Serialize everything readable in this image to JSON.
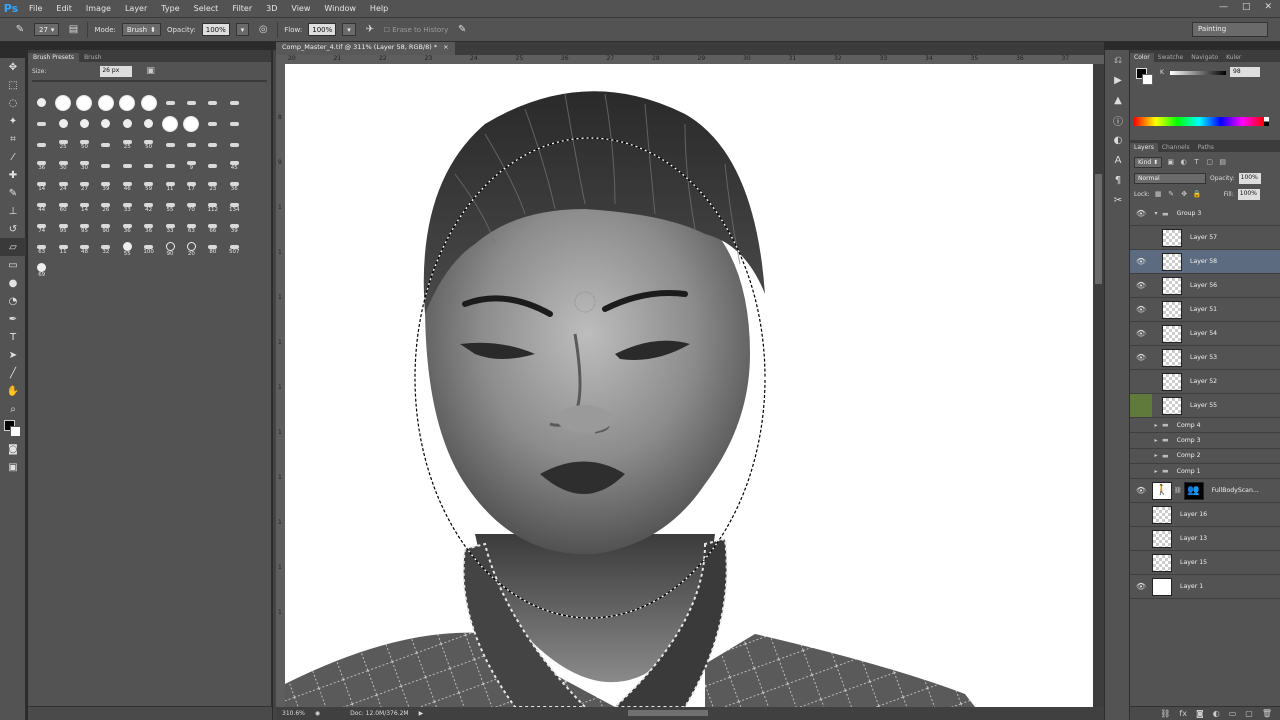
{
  "menubar": {
    "logo": "Ps",
    "items": [
      "File",
      "Edit",
      "Image",
      "Layer",
      "Type",
      "Select",
      "Filter",
      "3D",
      "View",
      "Window",
      "Help"
    ],
    "window_controls": [
      "—",
      "□",
      "✕"
    ]
  },
  "options": {
    "brush_size": "27",
    "mode_label": "Mode:",
    "mode_value": "Brush",
    "opacity_label": "Opacity:",
    "opacity_value": "100%",
    "flow_label": "Flow:",
    "flow_value": "100%",
    "erase_history": "Erase to History",
    "workspace": "Painting"
  },
  "brush_panel": {
    "tabs": [
      "Brush Presets",
      "Brush"
    ],
    "size_label": "Size:",
    "size_value": "26 px",
    "brushes": [
      [
        "",
        "sm"
      ],
      [
        "",
        "lg"
      ],
      [
        "",
        "lg"
      ],
      [
        "",
        "lg"
      ],
      [
        "",
        "lg"
      ],
      [
        "",
        "lg"
      ],
      [
        "",
        "tiny"
      ],
      [
        "",
        "tiny"
      ],
      [
        "",
        "tiny"
      ],
      [
        "",
        "tiny"
      ],
      [
        "",
        "tiny"
      ],
      [
        "",
        "sm"
      ],
      [
        "",
        "sm"
      ],
      [
        "",
        "sm"
      ],
      [
        "",
        "sm"
      ],
      [
        "",
        "sm"
      ],
      [
        "",
        "lg"
      ],
      [
        "",
        "lg"
      ],
      [
        "",
        "tiny"
      ],
      [
        "",
        "tiny"
      ],
      [
        "",
        "tiny"
      ],
      [
        "25",
        "tiny"
      ],
      [
        "50",
        "tiny"
      ],
      [
        "",
        "tiny"
      ],
      [
        "25",
        "tiny"
      ],
      [
        "50",
        "tiny"
      ],
      [
        "",
        "tiny"
      ],
      [
        "",
        "tiny"
      ],
      [
        "",
        "tiny"
      ],
      [
        "",
        "tiny"
      ],
      [
        "36",
        "tiny"
      ],
      [
        "30",
        "tiny"
      ],
      [
        "30",
        "tiny"
      ],
      [
        "",
        "tiny"
      ],
      [
        "",
        "tiny"
      ],
      [
        "",
        "tiny"
      ],
      [
        "",
        "tiny"
      ],
      [
        "9",
        "tiny"
      ],
      [
        "",
        "tiny"
      ],
      [
        "45",
        "tiny"
      ],
      [
        "14",
        "tiny"
      ],
      [
        "24",
        "tiny"
      ],
      [
        "27",
        "tiny"
      ],
      [
        "39",
        "tiny"
      ],
      [
        "46",
        "tiny"
      ],
      [
        "59",
        "tiny"
      ],
      [
        "11",
        "tiny"
      ],
      [
        "17",
        "tiny"
      ],
      [
        "23",
        "tiny"
      ],
      [
        "36",
        "tiny"
      ],
      [
        "44",
        "tiny"
      ],
      [
        "60",
        "tiny"
      ],
      [
        "14",
        "tiny"
      ],
      [
        "26",
        "tiny"
      ],
      [
        "33",
        "tiny"
      ],
      [
        "42",
        "tiny"
      ],
      [
        "55",
        "tiny"
      ],
      [
        "70",
        "tiny"
      ],
      [
        "112",
        "tiny"
      ],
      [
        "134",
        "tiny"
      ],
      [
        "74",
        "tiny"
      ],
      [
        "95",
        "tiny"
      ],
      [
        "95",
        "tiny"
      ],
      [
        "90",
        "tiny"
      ],
      [
        "36",
        "tiny"
      ],
      [
        "36",
        "tiny"
      ],
      [
        "33",
        "tiny"
      ],
      [
        "63",
        "tiny"
      ],
      [
        "66",
        "tiny"
      ],
      [
        "39",
        "tiny"
      ],
      [
        "63",
        "tiny"
      ],
      [
        "11",
        "tiny"
      ],
      [
        "48",
        "tiny"
      ],
      [
        "32",
        "tiny"
      ],
      [
        "55",
        "sm"
      ],
      [
        "100",
        "tiny"
      ],
      [
        "90",
        "ring"
      ],
      [
        "20",
        "ring"
      ],
      [
        "80",
        "tiny"
      ],
      [
        "507",
        "tiny"
      ],
      [
        "69",
        "sm"
      ]
    ]
  },
  "document": {
    "tab_title": "Comp_Master_4.tif @ 311% (Layer 58, RGB/8) *",
    "tab_close": "×",
    "ruler_h": [
      "20",
      "21",
      "22",
      "23",
      "24",
      "25",
      "26",
      "27",
      "28",
      "29",
      "30",
      "31",
      "32",
      "33",
      "34",
      "35",
      "36",
      "37"
    ],
    "ruler_v": [
      "8",
      "9",
      "1",
      "1",
      "1",
      "1",
      "1",
      "1",
      "1",
      "1",
      "1",
      "1"
    ],
    "zoom": "310.6%",
    "doc_info": "Doc: 12.0M/376.2M"
  },
  "right_panel": {
    "color_tabs": [
      "Color",
      "Swatche",
      "Navigato",
      "Kuler"
    ],
    "k_label": "K",
    "k_value": "98",
    "layer_tabs": [
      "Layers",
      "Channels",
      "Paths"
    ],
    "kind": "Kind",
    "blend_mode": "Normal",
    "opacity_label": "Opacity:",
    "opacity_value": "100%",
    "lock_label": "Lock:",
    "fill_label": "Fill:",
    "fill_value": "100%",
    "layers": [
      {
        "name": "Group 3",
        "kind": "group",
        "eye": "visible",
        "twirl": "▾"
      },
      {
        "name": "Layer 57",
        "kind": "layer",
        "eye": "hidden",
        "thumb": "checker"
      },
      {
        "name": "Layer 58",
        "kind": "layer",
        "eye": "visible",
        "thumb": "checker",
        "selected": true
      },
      {
        "name": "Layer 56",
        "kind": "layer",
        "eye": "visible",
        "thumb": "checker"
      },
      {
        "name": "Layer 51",
        "kind": "layer",
        "eye": "visible",
        "thumb": "checker"
      },
      {
        "name": "Layer 54",
        "kind": "layer",
        "eye": "visible",
        "thumb": "checker"
      },
      {
        "name": "Layer 53",
        "kind": "layer",
        "eye": "visible",
        "thumb": "checker"
      },
      {
        "name": "Layer 52",
        "kind": "layer",
        "eye": "hidden",
        "thumb": "checker"
      },
      {
        "name": "Layer 55",
        "kind": "layer",
        "eye": "green",
        "thumb": "checker"
      },
      {
        "name": "Comp 4",
        "kind": "group",
        "eye": "hidden",
        "twirl": "▸"
      },
      {
        "name": "Comp 3",
        "kind": "group",
        "eye": "hidden",
        "twirl": "▸"
      },
      {
        "name": "Comp 2",
        "kind": "group",
        "eye": "hidden",
        "twirl": "▸"
      },
      {
        "name": "Comp 1",
        "kind": "group",
        "eye": "hidden",
        "twirl": "▸"
      },
      {
        "name": "FullBodyScan...",
        "kind": "masked",
        "eye": "visible"
      },
      {
        "name": "Layer 16",
        "kind": "layer",
        "eye": "hidden",
        "thumb": "checker"
      },
      {
        "name": "Layer 13",
        "kind": "layer",
        "eye": "hidden",
        "thumb": "checker"
      },
      {
        "name": "Layer 15",
        "kind": "layer",
        "eye": "hidden",
        "thumb": "checker"
      },
      {
        "name": "Layer 1",
        "kind": "layer",
        "eye": "visible",
        "thumb": "white"
      }
    ]
  }
}
